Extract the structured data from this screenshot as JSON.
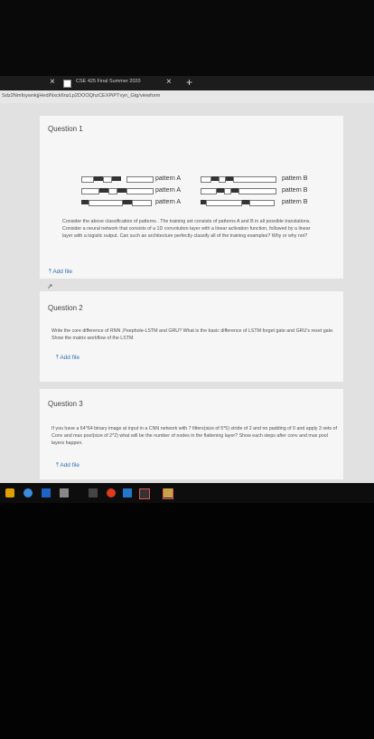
{
  "browser": {
    "tab_title": "CSE 425 Final Summer 2020",
    "tab_close": "×",
    "new_tab": "+",
    "url": "Sdz2NmfoywnkjjHed/Nxck6nzLp2DOOQhzCEXPiPTvyn_Gtg/viewform"
  },
  "questions": [
    {
      "title": "Question 1",
      "patterns_left": [
        "pattern A",
        "pattern A",
        "pattern A"
      ],
      "patterns_right": [
        "pattern B",
        "pattern B",
        "pattern B"
      ],
      "text": "Consider the above classification of patterns . The training set consists of patterns A and B in all possible translations. Consider a neural network that consists of a 1D convolution layer with a linear activation function, followed by a linear layer with a logistic output. Can such an architecture perfectly classify all of the training examples? Why or why not?",
      "add_file": "Add file"
    },
    {
      "title": "Question 2",
      "text": "Write the core difference of RNN ,Peephole-LSTM and GRU? What is the basic difference of LSTM forget gate and GRU's reset gate. Show the matrix workflow of the LSTM.",
      "add_file": "Add file"
    },
    {
      "title": "Question 3",
      "text": "If you have a 64*64 binary image at input in a CNN network with 7 filters(size of 5*5) stride of 2 and no padding of 0 and apply 3 sets of Conv and max pool(size of 2*2) what will be the number of nodes in the flattening layer? Show each steps after conv and max pool layers happen.",
      "add_file": "Add file"
    }
  ],
  "icons": {
    "upload": "upload-icon",
    "cursor": "mouse-cursor-icon"
  },
  "colors": {
    "link": "#2f6fb0",
    "page_bg": "#e1e1e1",
    "card_bg": "#f6f6f6"
  }
}
